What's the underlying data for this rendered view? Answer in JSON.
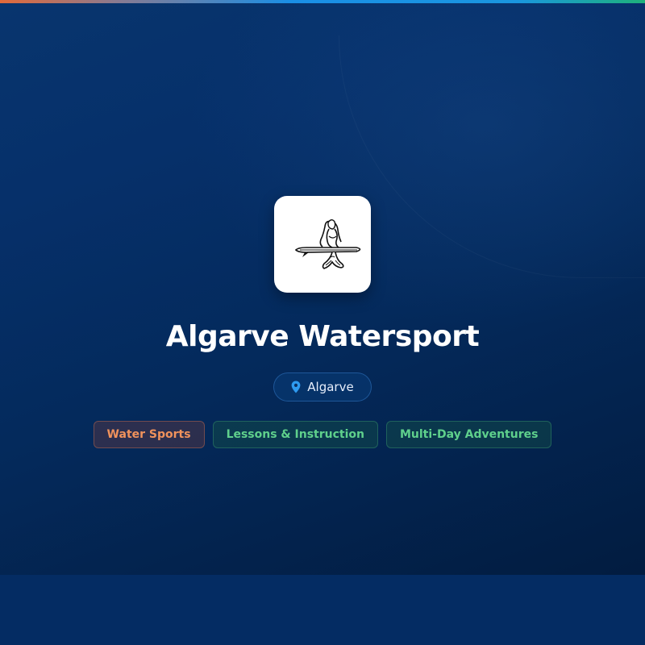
{
  "business": {
    "name": "Algarve Watersport",
    "location": "Algarve",
    "logo_icon": "mermaid-paddleboard-logo"
  },
  "tags": [
    {
      "label": "Water Sports",
      "color": "#f0925c"
    },
    {
      "label": "Lessons & Instruction",
      "color": "#5fd08c"
    },
    {
      "label": "Multi-Day Adventures",
      "color": "#5fd08c"
    }
  ],
  "icons": {
    "location": "map-pin-icon"
  },
  "colors": {
    "background": "#042a5c",
    "pin": "#2e9bf0",
    "accent_orange": "#e26a3a",
    "accent_blue": "#1a8fe6",
    "accent_green": "#1eb27a"
  }
}
